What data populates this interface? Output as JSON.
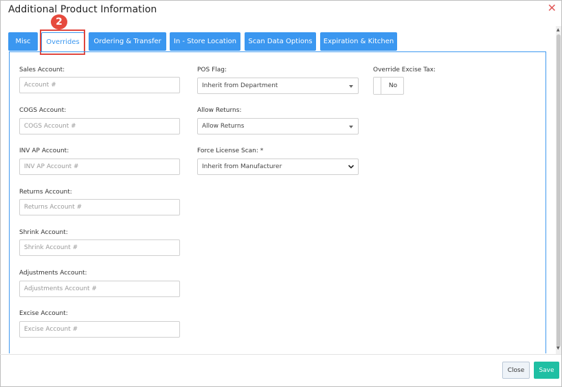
{
  "dialog": {
    "title": "Additional Product Information"
  },
  "annotation": {
    "step_number": "2"
  },
  "tabs": [
    {
      "label": "Misc",
      "active": false
    },
    {
      "label": "Overrides",
      "active": true
    },
    {
      "label": "Ordering & Transfer",
      "active": false
    },
    {
      "label": "In - Store Location",
      "active": false
    },
    {
      "label": "Scan Data Options",
      "active": false
    },
    {
      "label": "Expiration & Kitchen",
      "active": false
    }
  ],
  "accounts": {
    "sales": {
      "label": "Sales Account:",
      "placeholder": "Account #"
    },
    "cogs": {
      "label": "COGS Account:",
      "placeholder": "COGS Account #"
    },
    "inv_ap": {
      "label": "INV AP Account:",
      "placeholder": "INV AP Account #"
    },
    "returns": {
      "label": "Returns Account:",
      "placeholder": "Returns Account #"
    },
    "shrink": {
      "label": "Shrink Account:",
      "placeholder": "Shrink Account #"
    },
    "adjustments": {
      "label": "Adjustments Account:",
      "placeholder": "Adjustments Account #"
    },
    "excise": {
      "label": "Excise Account:",
      "placeholder": "Excise Account #"
    }
  },
  "options": {
    "pos_flag": {
      "label": "POS Flag:",
      "value": "Inherit from Department"
    },
    "allow_returns": {
      "label": "Allow Returns:",
      "value": "Allow Returns"
    },
    "force_license_scan": {
      "label": "Force License Scan: *",
      "value": "Inherit from Manufacturer"
    },
    "override_excise_tax": {
      "label": "Override Excise Tax:",
      "value": "No"
    }
  },
  "footer": {
    "close_label": "Close",
    "save_label": "Save"
  },
  "colors": {
    "accent": "#3b97f0",
    "save": "#1fbfa3",
    "highlight": "#e0453c",
    "close_icon": "#e15a5a"
  }
}
